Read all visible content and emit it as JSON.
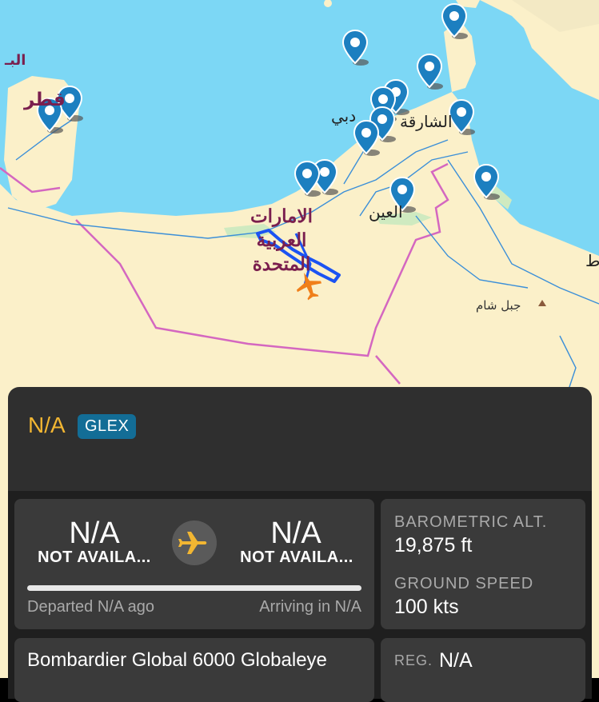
{
  "map": {
    "labels": {
      "qatar": "قطر",
      "bahrain": "البـ",
      "dubai": "دبي",
      "sharjah": "الشارقة",
      "al_ain": "العين",
      "uae_line1": "الامارات",
      "uae_line2": "العربية",
      "uae_line3": "المتحدة",
      "jebel_shams": "جبل شام",
      "oman": "ط"
    },
    "colors": {
      "sea": "#7cd7f5",
      "land": "#fbf0c9",
      "border": "#d467c0",
      "pin": "#1c7fc0",
      "track": "#1b53f2",
      "aircraft": "#f07f1a"
    }
  },
  "flight": {
    "callsign": "N/A",
    "aircraft_code": "GLEX",
    "origin_code": "N/A",
    "origin_name": "NOT AVAILA...",
    "destination_code": "N/A",
    "destination_name": "NOT AVAILA...",
    "departed": "Departed N/A ago",
    "arriving": "Arriving in N/A",
    "progress_fraction": 0,
    "aircraft_model": "Bombardier Global 6000 Globaleye"
  },
  "stats": {
    "baro_label": "BAROMETRIC ALT.",
    "baro_value": "19,875 ft",
    "speed_label": "GROUND SPEED",
    "speed_value": "100 kts",
    "reg_label": "REG.",
    "reg_value": "N/A"
  }
}
